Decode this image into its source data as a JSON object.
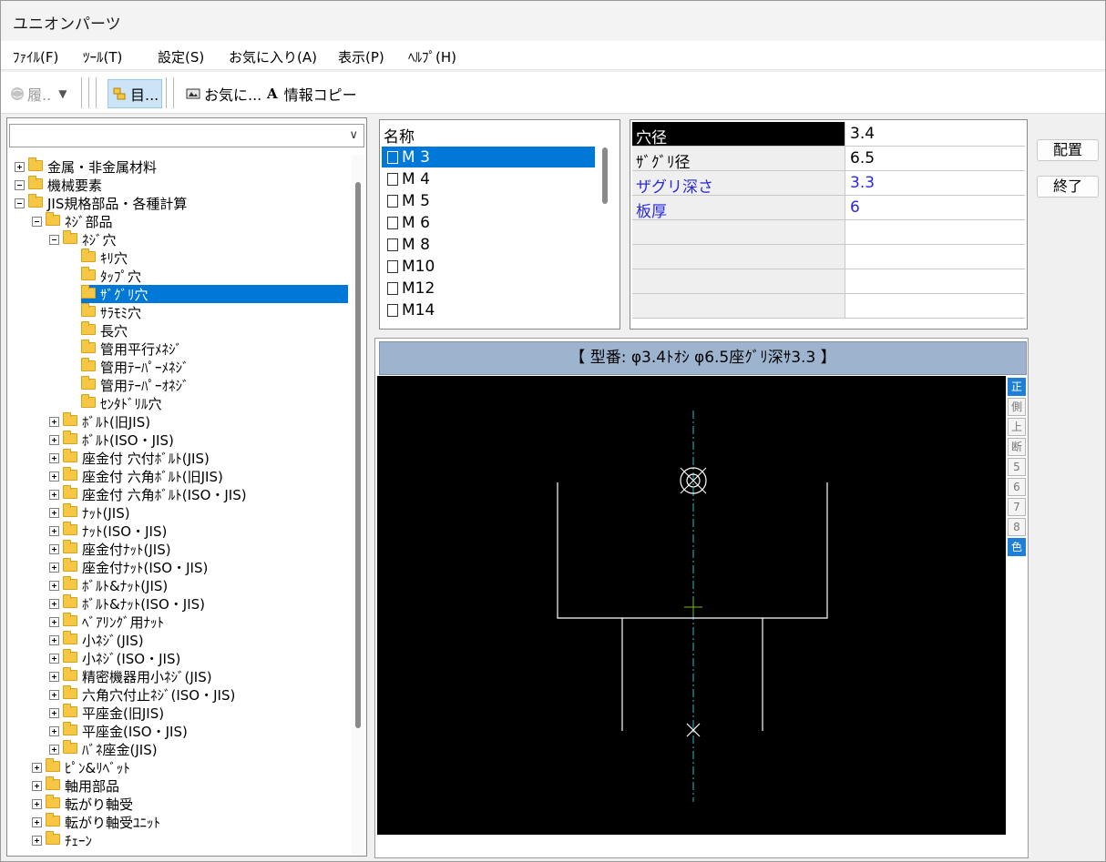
{
  "window": {
    "title": "ユニオンパーツ"
  },
  "menu": [
    "ﾌｧｲﾙ(F)",
    "ﾂｰﾙ(T)",
    "設定(S)",
    "お気に入り(A)",
    "表示(P)",
    "ﾍﾙﾌﾟ(H)"
  ],
  "toolbar": {
    "history_label": "履..",
    "contents_label": "目...",
    "favorites_label": "お気に...",
    "copy_info_label": "情報コピー"
  },
  "tree": {
    "combo_value": "",
    "nodes": [
      {
        "label": "金属・非金属材料",
        "level": 0,
        "expander": "plus",
        "selected": false
      },
      {
        "label": "機械要素",
        "level": 0,
        "expander": "minus",
        "selected": false
      },
      {
        "label": "JIS規格部品・各種計算",
        "level": 1,
        "expander": "minus",
        "selected": false
      },
      {
        "label": "ﾈｼﾞ部品",
        "level": 2,
        "expander": "minus",
        "selected": false
      },
      {
        "label": "ﾈｼﾞ穴",
        "level": 3,
        "expander": "minus",
        "selected": false
      },
      {
        "label": "ｷﾘ穴",
        "level": 4,
        "expander": "none",
        "selected": false
      },
      {
        "label": "ﾀｯﾌﾟ穴",
        "level": 4,
        "expander": "none",
        "selected": false
      },
      {
        "label": "ｻﾞｸﾞﾘ穴",
        "level": 4,
        "expander": "none",
        "selected": true
      },
      {
        "label": "ｻﾗﾓﾐ穴",
        "level": 4,
        "expander": "none",
        "selected": false
      },
      {
        "label": "長穴",
        "level": 4,
        "expander": "none",
        "selected": false
      },
      {
        "label": "管用平行ﾒﾈｼﾞ",
        "level": 4,
        "expander": "none",
        "selected": false
      },
      {
        "label": "管用ﾃｰﾊﾟｰﾒﾈｼﾞ",
        "level": 4,
        "expander": "none",
        "selected": false
      },
      {
        "label": "管用ﾃｰﾊﾟｰｵﾈｼﾞ",
        "level": 4,
        "expander": "none",
        "selected": false
      },
      {
        "label": "ｾﾝﾀﾄﾞﾘﾙ穴",
        "level": 4,
        "expander": "none",
        "selected": false
      },
      {
        "label": "ﾎﾞﾙﾄ(旧JIS)",
        "level": 3,
        "expander": "plus",
        "selected": false
      },
      {
        "label": "ﾎﾞﾙﾄ(ISO・JIS)",
        "level": 3,
        "expander": "plus",
        "selected": false
      },
      {
        "label": "座金付 穴付ﾎﾞﾙﾄ(JIS)",
        "level": 3,
        "expander": "plus",
        "selected": false
      },
      {
        "label": "座金付 六角ﾎﾞﾙﾄ(旧JIS)",
        "level": 3,
        "expander": "plus",
        "selected": false
      },
      {
        "label": "座金付 六角ﾎﾞﾙﾄ(ISO・JIS)",
        "level": 3,
        "expander": "plus",
        "selected": false
      },
      {
        "label": "ﾅｯﾄ(JIS)",
        "level": 3,
        "expander": "plus",
        "selected": false
      },
      {
        "label": "ﾅｯﾄ(ISO・JIS)",
        "level": 3,
        "expander": "plus",
        "selected": false
      },
      {
        "label": "座金付ﾅｯﾄ(JIS)",
        "level": 3,
        "expander": "plus",
        "selected": false
      },
      {
        "label": "座金付ﾅｯﾄ(ISO・JIS)",
        "level": 3,
        "expander": "plus",
        "selected": false
      },
      {
        "label": "ﾎﾞﾙﾄ&ﾅｯﾄ(JIS)",
        "level": 3,
        "expander": "plus",
        "selected": false
      },
      {
        "label": "ﾎﾞﾙﾄ&ﾅｯﾄ(ISO・JIS)",
        "level": 3,
        "expander": "plus",
        "selected": false
      },
      {
        "label": "ﾍﾞｱﾘﾝｸﾞ用ﾅｯﾄ",
        "level": 3,
        "expander": "plus",
        "selected": false
      },
      {
        "label": "小ﾈｼﾞ(JIS)",
        "level": 3,
        "expander": "plus",
        "selected": false
      },
      {
        "label": "小ﾈｼﾞ(ISO・JIS)",
        "level": 3,
        "expander": "plus",
        "selected": false
      },
      {
        "label": "精密機器用小ﾈｼﾞ(JIS)",
        "level": 3,
        "expander": "plus",
        "selected": false
      },
      {
        "label": "六角穴付止ﾈｼﾞ(ISO・JIS)",
        "level": 3,
        "expander": "plus",
        "selected": false
      },
      {
        "label": "平座金(旧JIS)",
        "level": 3,
        "expander": "plus",
        "selected": false
      },
      {
        "label": "平座金(ISO・JIS)",
        "level": 3,
        "expander": "plus",
        "selected": false
      },
      {
        "label": "ﾊﾞﾈ座金(JIS)",
        "level": 3,
        "expander": "plus",
        "selected": false
      },
      {
        "label": "ﾋﾟﾝ&ﾘﾍﾞｯﾄ",
        "level": 2,
        "expander": "plus",
        "selected": false
      },
      {
        "label": "軸用部品",
        "level": 2,
        "expander": "plus",
        "selected": false
      },
      {
        "label": "転がり軸受",
        "level": 2,
        "expander": "plus",
        "selected": false
      },
      {
        "label": "転がり軸受ﾕﾆｯﾄ",
        "level": 2,
        "expander": "plus",
        "selected": false
      },
      {
        "label": "ﾁｪｰﾝ",
        "level": 2,
        "expander": "plus",
        "selected": false
      }
    ]
  },
  "parts_list": {
    "header": "名称",
    "items": [
      "M 3",
      "M 4",
      "M 5",
      "M 6",
      "M 8",
      "M10",
      "M12",
      "M14"
    ],
    "selected_index": 0
  },
  "properties": {
    "rows": [
      {
        "key": "穴径",
        "value": "3.4",
        "key_style": "dark",
        "value_style": "normal"
      },
      {
        "key": "ｻﾞｸﾞﾘ径",
        "value": "6.5",
        "key_style": "normal",
        "value_style": "normal"
      },
      {
        "key": "ザグリ深さ",
        "value": "3.3",
        "key_style": "blue",
        "value_style": "blue"
      },
      {
        "key": "板厚",
        "value": "6",
        "key_style": "blue",
        "value_style": "blue"
      },
      {
        "key": "",
        "value": "",
        "key_style": "normal",
        "value_style": "normal"
      },
      {
        "key": "",
        "value": "",
        "key_style": "normal",
        "value_style": "normal"
      },
      {
        "key": "",
        "value": "",
        "key_style": "normal",
        "value_style": "normal"
      },
      {
        "key": "",
        "value": "",
        "key_style": "normal",
        "value_style": "normal"
      }
    ]
  },
  "side_buttons": {
    "place": "配置",
    "exit": "終了"
  },
  "preview": {
    "title": "【 型番: φ3.4ﾄｵｼ φ6.5座ｸﾞﾘ深ｻ3.3 】",
    "view_tabs": [
      {
        "label": "正",
        "active": true
      },
      {
        "label": "側",
        "active": false
      },
      {
        "label": "上",
        "active": false
      },
      {
        "label": "断",
        "active": false
      },
      {
        "label": "5",
        "active": false
      },
      {
        "label": "6",
        "active": false
      },
      {
        "label": "7",
        "active": false
      },
      {
        "label": "8",
        "active": false
      },
      {
        "label": "色",
        "active": true
      }
    ]
  },
  "colors": {
    "selection": "#0078d7",
    "preview_title_bg": "#9db4cf",
    "canvas_bg": "#000000",
    "blue_text": "#2a2ad8"
  }
}
